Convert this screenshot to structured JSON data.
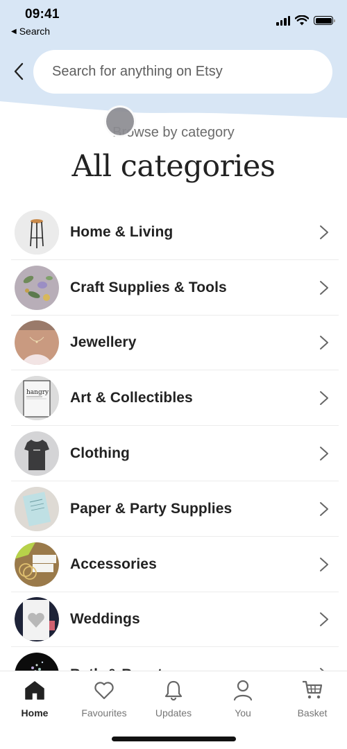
{
  "status_bar": {
    "time": "09:41",
    "back_app_label": "Search"
  },
  "search": {
    "placeholder": "Search for anything on Etsy",
    "value": ""
  },
  "header": {
    "subheading": "Browse by category",
    "title": "All categories"
  },
  "categories": [
    {
      "label": "Home & Living",
      "thumb": "bar-stool"
    },
    {
      "label": "Craft Supplies & Tools",
      "thumb": "botanical-prints"
    },
    {
      "label": "Jewellery",
      "thumb": "necklace-model"
    },
    {
      "label": "Art & Collectibles",
      "thumb": "hangry-print"
    },
    {
      "label": "Clothing",
      "thumb": "grey-tshirt"
    },
    {
      "label": "Paper & Party Supplies",
      "thumb": "invitation-card"
    },
    {
      "label": "Accessories",
      "thumb": "wedding-tags"
    },
    {
      "label": "Weddings",
      "thumb": "papercut-heart"
    },
    {
      "label": "Bath & Beauty",
      "thumb": "bath-confetti"
    }
  ],
  "bottom_nav": [
    {
      "label": "Home",
      "icon": "home-icon",
      "active": true
    },
    {
      "label": "Favourites",
      "icon": "heart-icon",
      "active": false
    },
    {
      "label": "Updates",
      "icon": "bell-icon",
      "active": false
    },
    {
      "label": "You",
      "icon": "user-icon",
      "active": false
    },
    {
      "label": "Basket",
      "icon": "cart-icon",
      "active": false
    }
  ],
  "colors": {
    "header_bg": "#d8e6f5",
    "text_primary": "#222222",
    "text_secondary": "#6b6b6b"
  }
}
